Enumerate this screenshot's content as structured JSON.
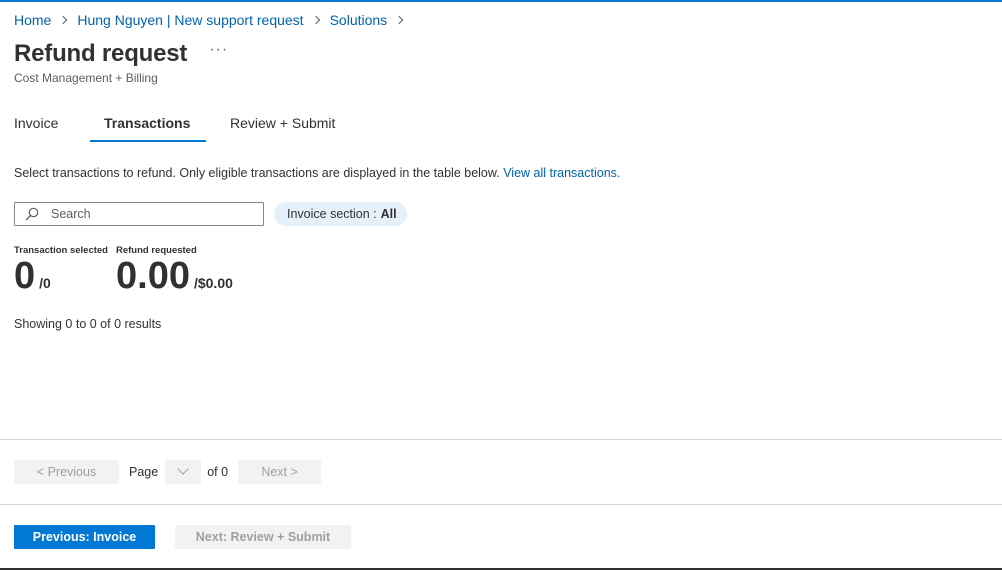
{
  "breadcrumb": [
    {
      "label": "Home"
    },
    {
      "label": "Hung Nguyen | New support request"
    },
    {
      "label": "Solutions"
    }
  ],
  "header": {
    "title": "Refund request",
    "more_label": "···",
    "subtitle": "Cost Management + Billing"
  },
  "tabs": [
    {
      "label": "Invoice",
      "selected": false
    },
    {
      "label": "Transactions",
      "selected": true
    },
    {
      "label": "Review + Submit",
      "selected": false
    }
  ],
  "description": {
    "text": "Select transactions to refund. Only eligible transactions are displayed in the table below. ",
    "link": "View all transactions."
  },
  "search": {
    "placeholder": "Search",
    "value": ""
  },
  "filter": {
    "label": "Invoice section : ",
    "value": "All"
  },
  "stats": {
    "transactions": {
      "label": "Transaction selected",
      "value": "0",
      "total": "/0"
    },
    "refund": {
      "label": "Refund requested",
      "value": "0.00",
      "total": "/$0.00"
    }
  },
  "results_text": "Showing 0 to 0 of 0 results",
  "pagination": {
    "previous_label": "< Previous",
    "page_label": "Page",
    "of_label": "of 0",
    "next_label": "Next >"
  },
  "footer": {
    "previous_label": "Previous: Invoice",
    "next_label": "Next: Review + Submit"
  },
  "colors": {
    "accent": "#0078d4",
    "link": "#0062ad",
    "pill_bg": "#e6f0fa",
    "disabled_bg": "#f3f2f1",
    "disabled_text": "#a19f9d"
  },
  "icons": {
    "search": "search-icon",
    "more": "more-icon",
    "dropdown": "chevron-down-icon",
    "breadcrumb_sep": "chevron-right-icon"
  }
}
